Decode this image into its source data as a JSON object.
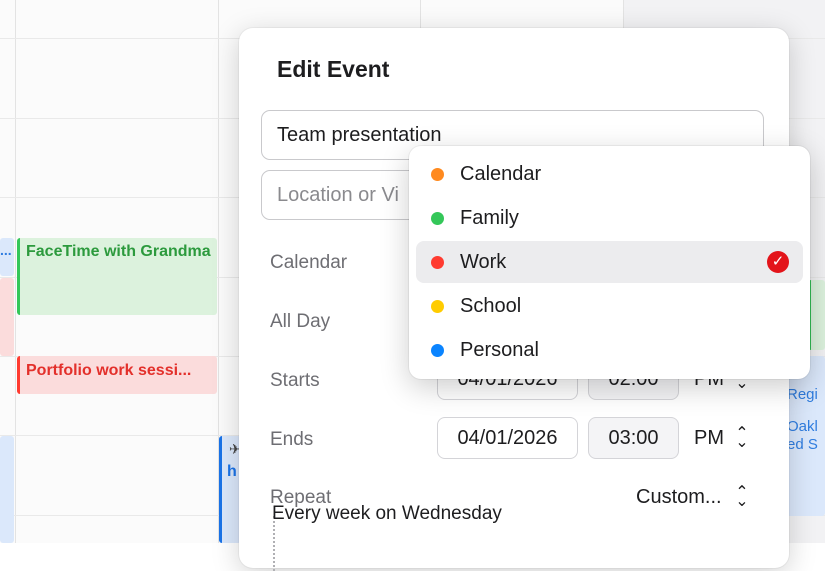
{
  "background_events": {
    "facetime": "FaceTime with Grandma",
    "portfolio": "Portfolio work sessi...",
    "right_lines": [
      "Regi",
      "Oakl",
      "ed S"
    ],
    "mid_text": "h",
    "left_fragment": "..."
  },
  "popover": {
    "title": "Edit Event",
    "event_title_value": "Team presentation",
    "location_placeholder": "Location or Vi",
    "labels": {
      "calendar": "Calendar",
      "all_day": "All Day",
      "starts": "Starts",
      "ends": "Ends",
      "repeat": "Repeat"
    },
    "starts": {
      "date": "04/01/2026",
      "time": "02:00",
      "ampm": "PM"
    },
    "ends": {
      "date": "04/01/2026",
      "time": "03:00",
      "ampm": "PM"
    },
    "repeat_value": "Custom...",
    "repeat_summary": "Every week on Wednesday"
  },
  "calendar_menu": {
    "selected": "Work",
    "items": [
      {
        "label": "Calendar",
        "color": "#ff8a1f"
      },
      {
        "label": "Family",
        "color": "#34c759"
      },
      {
        "label": "Work",
        "color": "#ff3b30"
      },
      {
        "label": "School",
        "color": "#ffcc00"
      },
      {
        "label": "Personal",
        "color": "#0a84ff"
      }
    ],
    "check_icon": "checkmark-icon"
  },
  "colors": {
    "accent_red": "#e3141a",
    "green_event": "#34c759",
    "red_event": "#ff3b30",
    "blue_event": "#1a73e8"
  }
}
